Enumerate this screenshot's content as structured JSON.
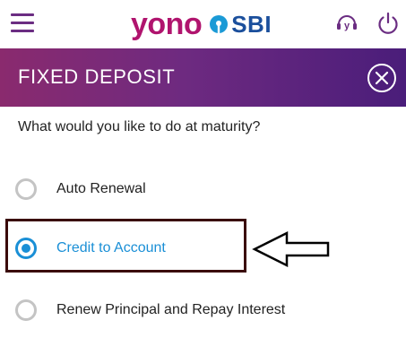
{
  "app": {
    "brand_primary": "yono",
    "brand_secondary": "SBI",
    "colors": {
      "brand_magenta": "#b0146e",
      "brand_blue": "#1b4f9c",
      "header_gradient_start": "#8a2a6e",
      "header_gradient_end": "#4a1d7a",
      "selected_blue": "#1a8fd6",
      "radio_unselected": "#c4c4c4"
    }
  },
  "topbar": {
    "menu_icon": "hamburger-menu-icon",
    "help_icon": "yono-help-icon",
    "help_glyph": "y",
    "power_icon": "power-icon"
  },
  "header": {
    "title": "FIXED DEPOSIT",
    "close_icon": "close-circle-icon"
  },
  "form": {
    "question": "What would you like to do at maturity?",
    "options": [
      {
        "label": "Auto Renewal",
        "selected": false
      },
      {
        "label": "Credit to Account",
        "selected": true
      },
      {
        "label": "Renew Principal and Repay Interest",
        "selected": false
      }
    ]
  },
  "annotation": {
    "highlight": "box-around-selected-option",
    "arrow_icon": "left-pointing-arrow-icon"
  }
}
